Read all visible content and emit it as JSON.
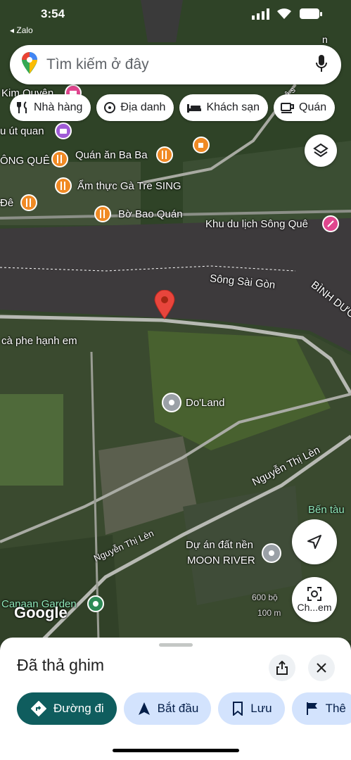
{
  "status_bar": {
    "time": "3:54",
    "back_label": "◂ Zalo"
  },
  "search": {
    "placeholder": "Tìm kiếm ở đây"
  },
  "chips": [
    "Nhà hàng",
    "Địa danh",
    "Khách sạn",
    "Quán"
  ],
  "map_labels": {
    "kim_quyen": "Kim Quyên",
    "u_ut_quan": "u út quan",
    "ong_que": "ÔNG QUÊ",
    "quan_an_ba_ba": "Quán ăn Ba Ba",
    "am_thuc_ga_tre": "Ẩm thực Gà Tre SING",
    "de": "Đê",
    "bo_bao_quan": "Bờ Bao Quán",
    "khu_du_lich": "Khu du lịch Sông Quê",
    "song_sai_gon": "Sông Sài Gòn",
    "binh_duong": "BÌNH DƯƠ",
    "ca_phe": "cà phe hạnh em",
    "doland": "Do'Land",
    "nguyen_thi_len_1": "Nguyễn Thị Lèn",
    "nguyen_thi_len_2": "Nguyễn Thị Lèn",
    "ben_tau": "Bến tàu",
    "du_an_line1": "Dự án đất nền",
    "du_an_line2": "MOON RIVER",
    "canaan": "Canaan Garden",
    "google": "Google",
    "scale_m": "600 bộ",
    "scale_m2": "100 m",
    "chemtext": "Ch...em",
    "corner_text": "ệ s",
    "corner_text2": "n"
  },
  "sheet": {
    "title": "Đã thả ghim",
    "actions": [
      "Đường đi",
      "Bắt đầu",
      "Lưu",
      "Thê"
    ]
  },
  "colors": {
    "pin_red": "#e8453c",
    "chip_primary": "#0f5d5e",
    "chip_secondary": "#d3e3fd",
    "river": "#3d3a3c"
  }
}
